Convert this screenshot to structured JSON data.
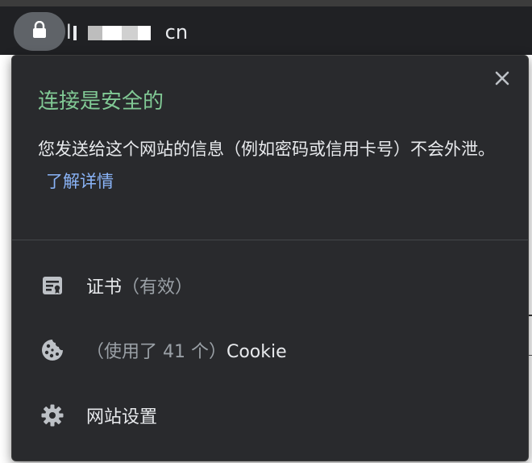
{
  "browser": {
    "url_prefix": "l",
    "url_tail": "cn"
  },
  "popup": {
    "title": "连接是安全的",
    "description": "您发送给这个网站的信息（例如密码或信用卡号）不会外泄。",
    "learn_more": "了解详情",
    "rows": [
      {
        "label": "证书",
        "status": "（有效）",
        "icon": "certificate-icon"
      },
      {
        "prefix": "（使用了 41 个）",
        "label": "Cookie",
        "icon": "cookie-icon"
      },
      {
        "label": "网站设置",
        "icon": "gear-icon"
      }
    ]
  },
  "colors": {
    "title_green": "#81c995",
    "link_blue": "#8ab4f8",
    "popup_bg": "#292a2d"
  }
}
